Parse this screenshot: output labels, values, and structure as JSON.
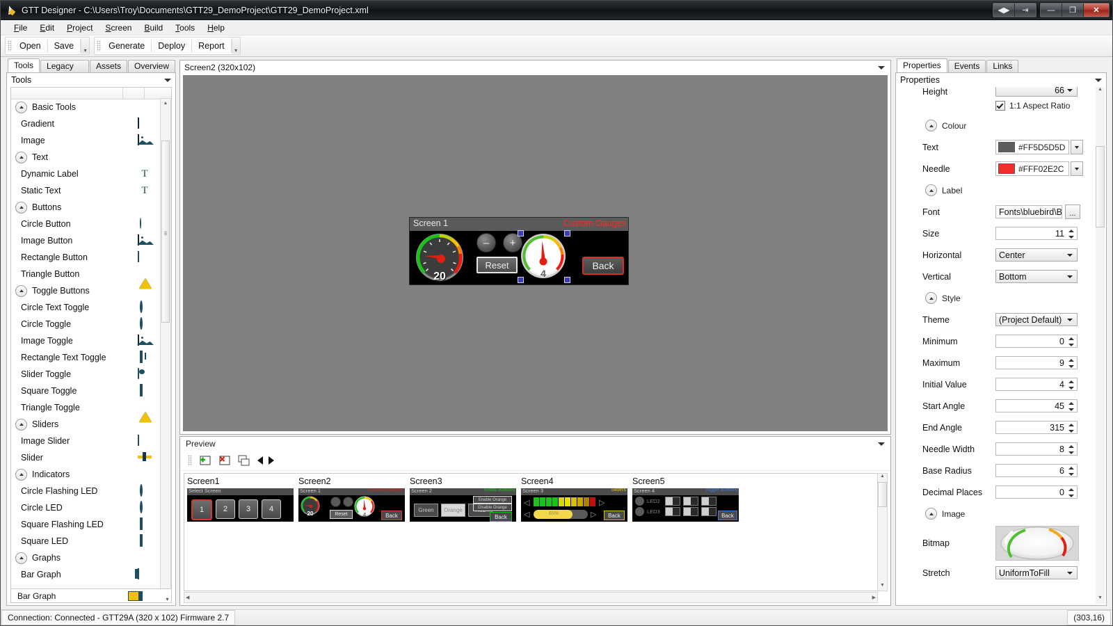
{
  "window": {
    "title": "GTT Designer - C:\\Users\\Troy\\Documents\\GTT29_DemoProject\\GTT29_DemoProject.xml",
    "buttons": {
      "split": "◀▶",
      "restore_tool": "⇥",
      "minimize": "—",
      "maximize": "❐",
      "close": "✕"
    }
  },
  "menu": {
    "items": [
      "File",
      "Edit",
      "Project",
      "Screen",
      "Build",
      "Tools",
      "Help"
    ]
  },
  "toolbar": {
    "group1": [
      "Open",
      "Save"
    ],
    "group2": [
      "Generate",
      "Deploy",
      "Report"
    ]
  },
  "left_tabs": {
    "items": [
      "Tools",
      "Legacy Tools",
      "Assets",
      "Overview"
    ],
    "selected": "Tools"
  },
  "tools_panel": {
    "header": "Tools",
    "footer_item": {
      "label": "Bar Graph",
      "icon": "bar-graph-icon"
    },
    "items": [
      {
        "label": "Basic Tools",
        "type": "group",
        "icon": "collapse-chevron-icon"
      },
      {
        "label": "Gradient",
        "type": "item",
        "icon": "gradient-icon"
      },
      {
        "label": "Image",
        "type": "item",
        "icon": "image-icon"
      },
      {
        "label": "Text",
        "type": "group",
        "icon": "collapse-chevron-icon"
      },
      {
        "label": "Dynamic Label",
        "type": "item",
        "icon": "dynamic-label-icon"
      },
      {
        "label": "Static Text",
        "type": "item",
        "icon": "static-text-icon"
      },
      {
        "label": "Buttons",
        "type": "group",
        "icon": "collapse-chevron-icon"
      },
      {
        "label": "Circle Button",
        "type": "item",
        "icon": "circle-button-icon"
      },
      {
        "label": "Image Button",
        "type": "item",
        "icon": "image-button-icon"
      },
      {
        "label": "Rectangle Button",
        "type": "item",
        "icon": "rectangle-button-icon"
      },
      {
        "label": "Triangle Button",
        "type": "item",
        "icon": "triangle-button-icon"
      },
      {
        "label": "Toggle Buttons",
        "type": "group",
        "icon": "collapse-chevron-icon"
      },
      {
        "label": "Circle Text Toggle",
        "type": "item",
        "icon": "circle-text-toggle-icon"
      },
      {
        "label": "Circle Toggle",
        "type": "item",
        "icon": "circle-toggle-icon"
      },
      {
        "label": "Image Toggle",
        "type": "item",
        "icon": "image-toggle-icon"
      },
      {
        "label": "Rectangle Text Toggle",
        "type": "item",
        "icon": "rectangle-text-toggle-icon"
      },
      {
        "label": "Slider Toggle",
        "type": "item",
        "icon": "slider-toggle-icon"
      },
      {
        "label": "Square Toggle",
        "type": "item",
        "icon": "square-toggle-icon"
      },
      {
        "label": "Triangle Toggle",
        "type": "item",
        "icon": "triangle-toggle-icon"
      },
      {
        "label": "Sliders",
        "type": "group",
        "icon": "collapse-chevron-icon"
      },
      {
        "label": "Image Slider",
        "type": "item",
        "icon": "image-slider-icon"
      },
      {
        "label": "Slider",
        "type": "item",
        "icon": "slider-icon"
      },
      {
        "label": "Indicators",
        "type": "group",
        "icon": "collapse-chevron-icon"
      },
      {
        "label": "Circle Flashing LED",
        "type": "item",
        "icon": "circle-flashing-led-icon"
      },
      {
        "label": "Circle LED",
        "type": "item",
        "icon": "circle-led-icon"
      },
      {
        "label": "Square Flashing LED",
        "type": "item",
        "icon": "square-flashing-led-icon"
      },
      {
        "label": "Square LED",
        "type": "item",
        "icon": "square-led-icon"
      },
      {
        "label": "Graphs",
        "type": "group",
        "icon": "collapse-chevron-icon"
      },
      {
        "label": "Bar Graph",
        "type": "item",
        "icon": "bar-graph-icon"
      }
    ]
  },
  "canvas": {
    "title": "Screen2 (320x102)",
    "device": {
      "header_left": "Screen 1",
      "header_right": "Custom Gauges",
      "gauge_left_value": "20",
      "gauge_right_value": "4",
      "minus_label": "–",
      "plus_label": "+",
      "reset_label": "Reset",
      "back_label": "Back"
    }
  },
  "preview": {
    "header": "Preview",
    "toolbar_icons": [
      "add-screen-icon",
      "delete-screen-icon",
      "duplicate-screen-icon",
      "previous-screen-icon",
      "next-screen-icon"
    ],
    "screens": [
      {
        "name": "Screen1",
        "header_left": "Select Screen",
        "header_right": "",
        "header_right_color": "#3a3a3a",
        "kind": "buttons",
        "buttons": [
          "1",
          "2",
          "3",
          "4"
        ]
      },
      {
        "name": "Screen2",
        "header_left": "Screen 1",
        "header_right": "Custom Gauges",
        "header_right_color": "#d32a18",
        "kind": "gauges",
        "gauge_left_value": "20",
        "gauge_right_value": "4",
        "reset_label": "Reset",
        "back_label": "Back"
      },
      {
        "name": "Screen3",
        "header_left": "Screen 2",
        "header_right": "Radio Buttons",
        "header_right_color": "#19c419",
        "kind": "radio",
        "buttons": [
          "Green",
          "Orange",
          "Red"
        ],
        "toggles": [
          "Enable Orange",
          "Disable Orange"
        ],
        "back_label": "Back"
      },
      {
        "name": "Screen4",
        "header_left": "Screen 3",
        "header_right": "Sliders",
        "header_right_color": "#f0c000",
        "kind": "sliders",
        "slider_value": "65%",
        "back_label": "Back"
      },
      {
        "name": "Screen5",
        "header_left": "Screen 4",
        "header_right": "Toggle Buttons",
        "header_right_color": "#3a7fe0",
        "kind": "toggles",
        "leds": [
          "LED2",
          "LED3"
        ],
        "back_label": "Back"
      }
    ]
  },
  "right_tabs": {
    "items": [
      "Properties",
      "Events",
      "Links"
    ],
    "selected": "Properties"
  },
  "properties": {
    "header": "Properties",
    "clipped_top_row": {
      "label": "Height",
      "value": "66"
    },
    "aspect_ratio": {
      "label": "1:1 Aspect Ratio",
      "checked": true
    },
    "groups": [
      {
        "label": "Colour",
        "rows": [
          {
            "label": "Text",
            "kind": "color",
            "value": "#FF5D5D5D",
            "swatch": "#5D5D5D"
          },
          {
            "label": "Needle",
            "kind": "color",
            "value": "#FFF02E2C",
            "swatch": "#F02E2C"
          }
        ]
      },
      {
        "label": "Label",
        "rows": [
          {
            "label": "Font",
            "kind": "file",
            "value": "Fonts\\bluebird\\B",
            "button": "..."
          },
          {
            "label": "Size",
            "kind": "spin",
            "value": "11"
          },
          {
            "label": "Horizontal",
            "kind": "select",
            "value": "Center"
          },
          {
            "label": "Vertical",
            "kind": "select",
            "value": "Bottom"
          }
        ]
      },
      {
        "label": "Style",
        "rows": [
          {
            "label": "Theme",
            "kind": "select",
            "value": "(Project Default)"
          },
          {
            "label": "Minimum",
            "kind": "spin",
            "value": "0"
          },
          {
            "label": "Maximum",
            "kind": "spin",
            "value": "9"
          },
          {
            "label": "Initial Value",
            "kind": "spin",
            "value": "4"
          },
          {
            "label": "Start Angle",
            "kind": "spin",
            "value": "45"
          },
          {
            "label": "End Angle",
            "kind": "spin",
            "value": "315"
          },
          {
            "label": "Needle Width",
            "kind": "spin",
            "value": "8"
          },
          {
            "label": "Base Radius",
            "kind": "spin",
            "value": "6"
          },
          {
            "label": "Decimal Places",
            "kind": "spin",
            "value": "0"
          }
        ]
      },
      {
        "label": "Image",
        "rows": [
          {
            "label": "Bitmap",
            "kind": "bitmap",
            "value": ""
          },
          {
            "label": "Stretch",
            "kind": "select",
            "value": "UniformToFill"
          }
        ]
      }
    ]
  },
  "statusbar": {
    "connection": "Connection: Connected - GTT29A (320 x 102) Firmware 2.7",
    "coordinates": "(303,16)"
  }
}
